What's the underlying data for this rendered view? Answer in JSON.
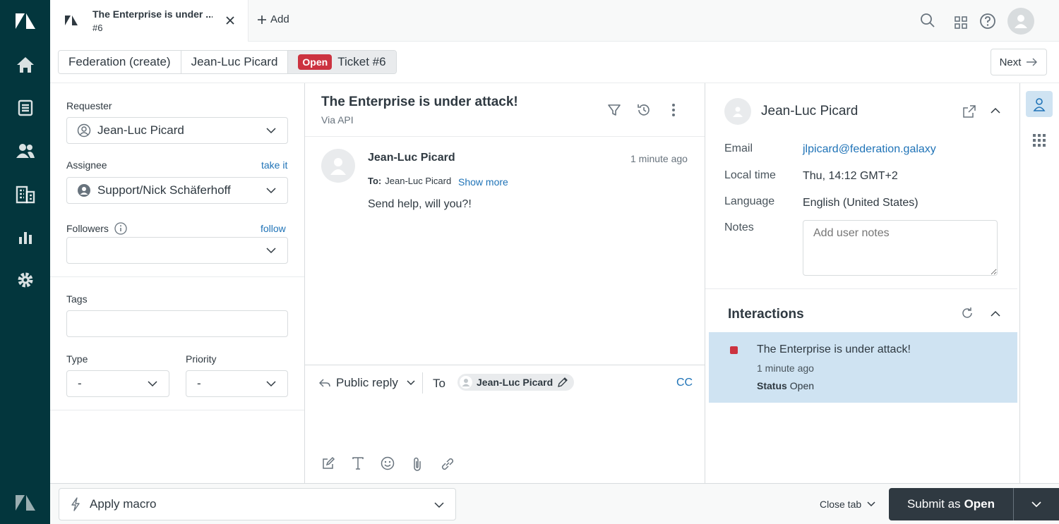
{
  "tab": {
    "title": "The Enterprise is under ...",
    "subtitle": "#6",
    "add_label": "Add"
  },
  "breadcrumb": {
    "items": [
      "Federation (create)",
      "Jean-Luc Picard"
    ],
    "status_badge": "Open",
    "ticket_label": "Ticket #6"
  },
  "next_label": "Next",
  "properties": {
    "requester_label": "Requester",
    "requester_value": "Jean-Luc Picard",
    "assignee_label": "Assignee",
    "assignee_link": "take it",
    "assignee_value": "Support/Nick Schäferhoff",
    "followers_label": "Followers",
    "followers_link": "follow",
    "tags_label": "Tags",
    "type_label": "Type",
    "type_value": "-",
    "priority_label": "Priority",
    "priority_value": "-"
  },
  "conversation": {
    "title": "The Enterprise is under attack!",
    "via": "Via API",
    "message": {
      "author": "Jean-Luc Picard",
      "time": "1 minute ago",
      "to_label": "To:",
      "to_value": "Jean-Luc Picard",
      "show_more": "Show more",
      "body": "Send help, will you?!"
    },
    "composer": {
      "reply_type": "Public reply",
      "to_label": "To",
      "recipient": "Jean-Luc Picard",
      "cc_label": "CC"
    }
  },
  "user_panel": {
    "name": "Jean-Luc Picard",
    "email_label": "Email",
    "email": "jlpicard@federation.galaxy",
    "local_time_label": "Local time",
    "local_time": "Thu, 14:12 GMT+2",
    "language_label": "Language",
    "language": "English (United States)",
    "notes_label": "Notes",
    "notes_placeholder": "Add user notes",
    "interactions_title": "Interactions",
    "interaction": {
      "title": "The Enterprise is under attack!",
      "time": "1 minute ago",
      "status_label": "Status",
      "status_value": "Open"
    }
  },
  "bottom": {
    "macro_label": "Apply macro",
    "close_tab_label": "Close tab",
    "submit_prefix": "Submit as",
    "submit_status": "Open"
  },
  "colors": {
    "nav_bg": "#03363d",
    "status_open": "#cc3340",
    "link": "#1f73b7",
    "interaction_highlight": "#cfe3f2",
    "submit_bg": "#2f3941"
  }
}
